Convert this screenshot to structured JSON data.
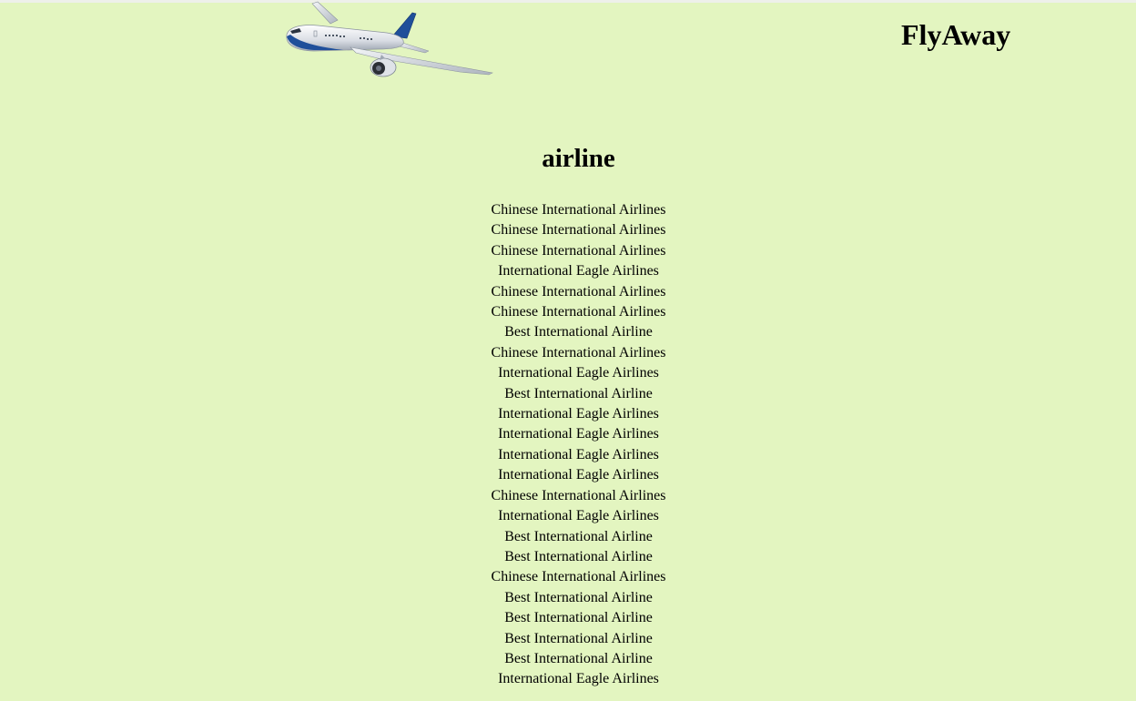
{
  "header": {
    "brand": "FlyAway",
    "logo_icon": "airplane-icon"
  },
  "main": {
    "heading": "airline",
    "airlines": [
      "Chinese International Airlines",
      "Chinese International Airlines",
      "Chinese International Airlines",
      "International Eagle Airlines",
      "Chinese International Airlines",
      "Chinese International Airlines",
      "Best International Airline",
      "Chinese International Airlines",
      "International Eagle Airlines",
      "Best International Airline",
      "International Eagle Airlines",
      "International Eagle Airlines",
      "International Eagle Airlines",
      "International Eagle Airlines",
      "Chinese International Airlines",
      "International Eagle Airlines",
      "Best International Airline",
      "Best International Airline",
      "Chinese International Airlines",
      "Best International Airline",
      "Best International Airline",
      "Best International Airline",
      "Best International Airline",
      "International Eagle Airlines"
    ]
  },
  "colors": {
    "background": "#e3f5c0",
    "plane_body": "#e8ebf0",
    "plane_accent": "#1f4f9a"
  }
}
